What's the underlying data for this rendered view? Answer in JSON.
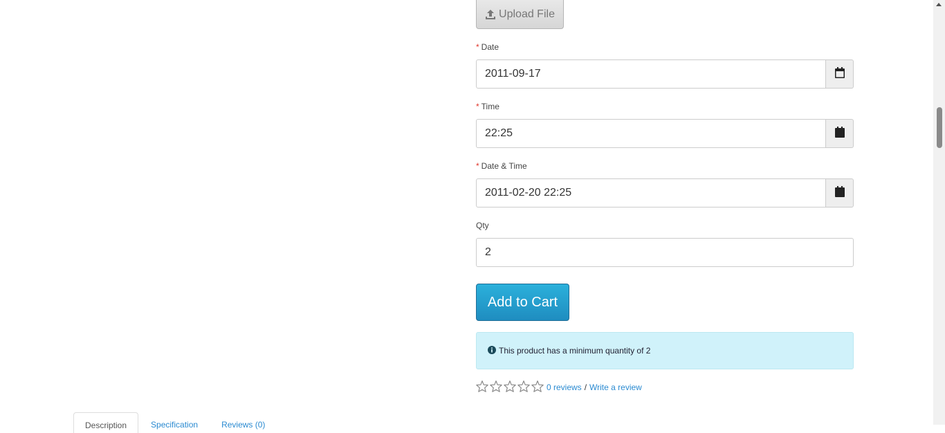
{
  "upload": {
    "label": "Upload File",
    "icon": "upload-icon"
  },
  "fields": {
    "date": {
      "required_mark": "*",
      "label": "Date",
      "value": "2011-09-17",
      "icon": "calendar-icon"
    },
    "time": {
      "required_mark": "*",
      "label": "Time",
      "value": "22:25",
      "icon": "calendar-icon"
    },
    "datetime": {
      "required_mark": "*",
      "label": "Date & Time",
      "value": "2011-02-20 22:25",
      "icon": "calendar-icon"
    },
    "qty": {
      "label": "Qty",
      "value": "2"
    }
  },
  "cart": {
    "button_label": "Add to Cart",
    "color": "#229ac8"
  },
  "alert": {
    "icon": "info-circle-icon",
    "text": "This product has a minimum quantity of 2"
  },
  "rating": {
    "stars_filled": 0,
    "stars_total": 5,
    "reviews_link": "0 reviews",
    "separator": "/",
    "write_link": "Write a review"
  },
  "tabs": [
    {
      "label": "Description"
    },
    {
      "label": "Specification"
    },
    {
      "label": "Reviews (0)"
    }
  ],
  "colors": {
    "required": "#e0362b",
    "link": "#2a8ad1",
    "alert_bg": "#d0f2fa"
  }
}
